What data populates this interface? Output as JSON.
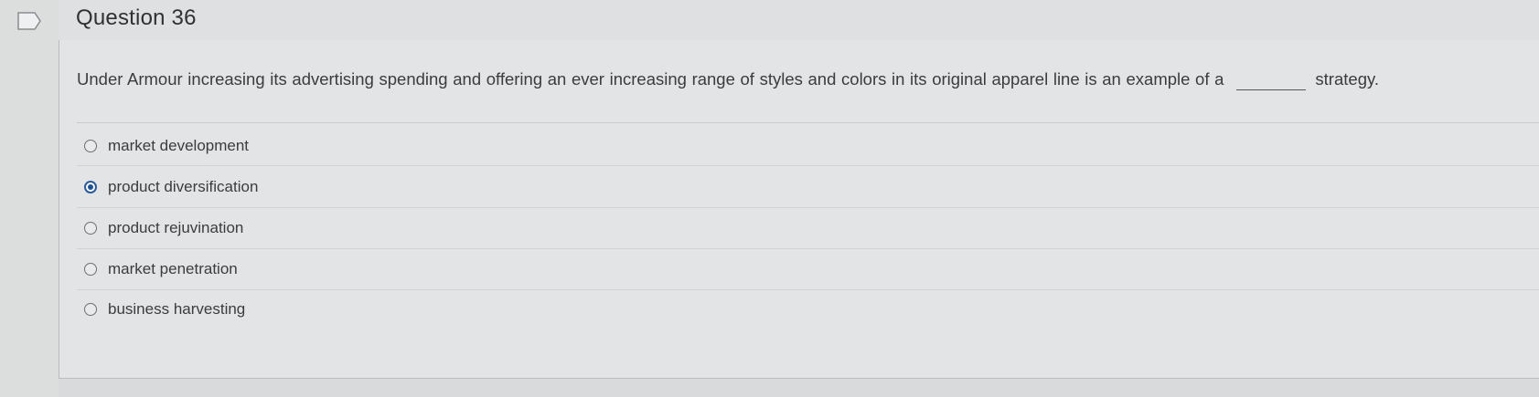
{
  "question": {
    "title": "Question 36",
    "text_before_blank": "Under Armour increasing its advertising spending and offering an ever increasing range of styles and colors in its original apparel line is an example of a",
    "text_after_blank": "strategy."
  },
  "options": [
    {
      "label": "market development",
      "selected": false
    },
    {
      "label": "product diversification",
      "selected": true
    },
    {
      "label": "product rejuvination",
      "selected": false
    },
    {
      "label": "market penetration",
      "selected": false
    },
    {
      "label": "business harvesting",
      "selected": false
    }
  ],
  "colors": {
    "selected_radio": "#1f4f93",
    "background": "#d9dadb"
  },
  "icons": {
    "flag": "flag-outline-icon"
  }
}
